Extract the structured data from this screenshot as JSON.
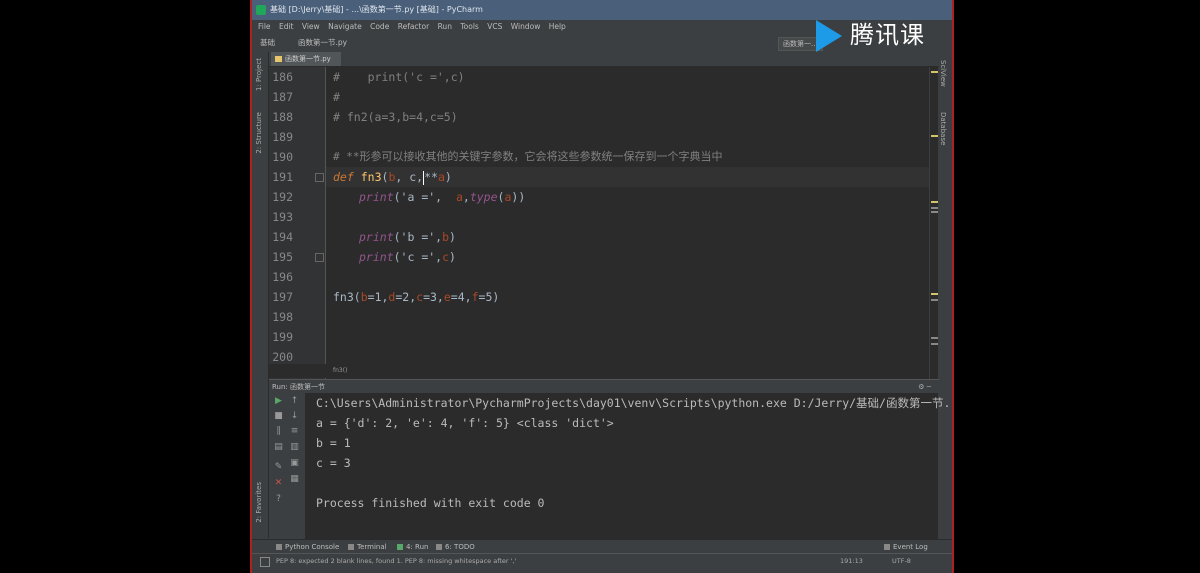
{
  "window": {
    "title": "基础 [D:\\Jerry\\基础] - ...\\函数第一节.py [基础] - PyCharm"
  },
  "menu": [
    "File",
    "Edit",
    "View",
    "Navigate",
    "Code",
    "Refactor",
    "Run",
    "Tools",
    "VCS",
    "Window",
    "Help"
  ],
  "navbar": {
    "project": "基础",
    "file": "函数第一节.py",
    "run_config": "函数第一..."
  },
  "watermark": {
    "text": "腾讯课堂"
  },
  "side_left": {
    "project": "1: Project",
    "structure": "2: Structure",
    "favorites": "2: Favorites"
  },
  "side_right": {
    "scientific": "SciView",
    "database": "Database"
  },
  "editor": {
    "tab": "函数第一节.py",
    "lines": [
      {
        "n": "186"
      },
      {
        "n": "187"
      },
      {
        "n": "188"
      },
      {
        "n": "189"
      },
      {
        "n": "190"
      },
      {
        "n": "191"
      },
      {
        "n": "192"
      },
      {
        "n": "193"
      },
      {
        "n": "194"
      },
      {
        "n": "195"
      },
      {
        "n": "196"
      },
      {
        "n": "197"
      },
      {
        "n": "198"
      },
      {
        "n": "199"
      },
      {
        "n": "200"
      }
    ],
    "code": {
      "l186a": "#",
      "l186b": "    print('c =',c)",
      "l187": "#",
      "l188": "# fn2(a=3,b=4,c=5)",
      "l190": "# **形参可以接收其他的关键字参数，它会将这些参数统一保存到一个字典当中",
      "l191_kw": "def",
      "l191_fn": "fn3",
      "l191_p1": "(",
      "l191_b": "b",
      "l191_c": ", c,",
      "l191_star": "**",
      "l191_a": "a",
      "l191_end": ")",
      "l192_pr": "print",
      "l192_s": "('a =',  ",
      "l192_a": "a",
      "l192_c": ",",
      "l192_t": "type",
      "l192_p": "(",
      "l192_a2": "a",
      "l192_e": "))",
      "l194_pr": "print",
      "l194_s": "('b =',",
      "l194_v": "b",
      "l194_e": ")",
      "l195_pr": "print",
      "l195_s": "('c =',",
      "l195_v": "c",
      "l195_e": ")",
      "l197_fn": "fn3(",
      "l197_b": "b",
      "l197_b2": "=1,",
      "l197_d": "d",
      "l197_d2": "=2,",
      "l197_c": "c",
      "l197_c2": "=3,",
      "l197_e": "e",
      "l197_e2": "=4,",
      "l197_f": "f",
      "l197_f2": "=5)"
    },
    "breadcrumb": "fn3()"
  },
  "run_panel": {
    "header": "Run: 函数第一节",
    "output": [
      "C:\\Users\\Administrator\\PycharmProjects\\day01\\venv\\Scripts\\python.exe D:/Jerry/基础/函数第一节.",
      "a = {'d': 2, 'e': 4, 'f': 5} <class 'dict'>",
      "b = 1",
      "c = 3",
      "",
      "Process finished with exit code 0"
    ]
  },
  "bottom_tabs": {
    "python_console": "Python Console",
    "terminal": "Terminal",
    "run": "4: Run",
    "todo": "6: TODO",
    "event_log": "Event Log"
  },
  "status": {
    "message": "PEP 8: expected 2 blank lines, found 1. PEP 8: missing whitespace after ','",
    "position": "191:13",
    "encoding": "UTF-8"
  }
}
